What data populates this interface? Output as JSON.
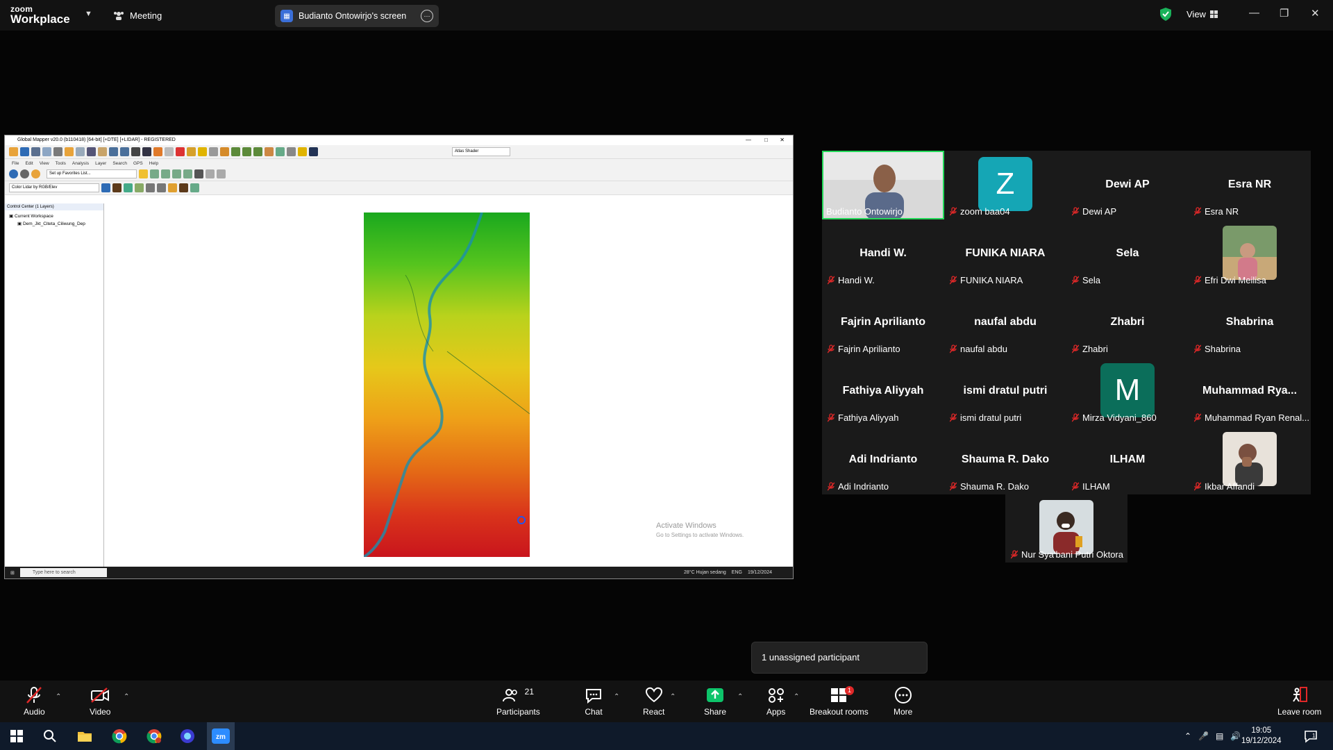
{
  "titlebar": {
    "logo_small": "zoom",
    "logo_big": "Workplace",
    "meeting_label": "Meeting",
    "share_label": "Budianto Ontowirjo's screen",
    "view_label": "View"
  },
  "shared_screen": {
    "window_title": "Global Mapper v20.0 (b110418) [64-bit] [+DTE] [+LIDAR] - REGISTERED",
    "menu": [
      "File",
      "Edit",
      "View",
      "Tools",
      "Analysis",
      "Layer",
      "Search",
      "GPS",
      "Help"
    ],
    "shader_select": "Atlas Shader",
    "favorites_select": "Set up Favorites List...",
    "lidar_select": "Color Lidar by RGB/Elev",
    "control_center": "Control Center (1 Layers)",
    "tree_workspace": "Current Workspace",
    "tree_layer": "Dem_Jkt_Citeta_Ciliwung_Dep",
    "watermark_title": "Activate Windows",
    "watermark_sub": "Go to Settings to activate Windows.",
    "taskbar_search": "Type here to search",
    "weather": "28°C  Hujan sedang",
    "lang": "ENG",
    "date": "19/12/2024"
  },
  "participants": [
    {
      "display": "",
      "label": "Budianto Ontowirjo",
      "type": "video"
    },
    {
      "display": "Z",
      "label": "zoom baa04",
      "type": "letter",
      "color": "#15a6b5"
    },
    {
      "display": "Dewi AP",
      "label": "Dewi AP",
      "type": "name"
    },
    {
      "display": "Esra NR",
      "label": "Esra NR",
      "type": "name"
    },
    {
      "display": "Handi W.",
      "label": "Handi W.",
      "type": "name"
    },
    {
      "display": "FUNIKA NIARA",
      "label": "FUNIKA NIARA",
      "type": "name"
    },
    {
      "display": "Sela",
      "label": "Sela",
      "type": "name"
    },
    {
      "display": "",
      "label": "Efri Dwi Meilisa",
      "type": "photo"
    },
    {
      "display": "Fajrin Aprilianto",
      "label": "Fajrin Aprilianto",
      "type": "name"
    },
    {
      "display": "naufal abdu",
      "label": "naufal abdu",
      "type": "name"
    },
    {
      "display": "Zhabri",
      "label": "Zhabri",
      "type": "name"
    },
    {
      "display": "Shabrina",
      "label": "Shabrina",
      "type": "name"
    },
    {
      "display": "Fathiya Aliyyah",
      "label": "Fathiya Aliyyah",
      "type": "name"
    },
    {
      "display": "ismi dratul putri",
      "label": "ismi dratul putri",
      "type": "name"
    },
    {
      "display": "M",
      "label": "Mirza Vidyani_860",
      "type": "letter",
      "color": "#0b6e5a"
    },
    {
      "display": "Muhammad  Rya...",
      "label": "Muhammad Ryan Renal...",
      "type": "name"
    },
    {
      "display": "Adi Indrianto",
      "label": "Adi Indrianto",
      "type": "name"
    },
    {
      "display": "Shauma R. Dako",
      "label": "Shauma R. Dako",
      "type": "name"
    },
    {
      "display": "ILHAM",
      "label": "ILHAM",
      "type": "name"
    },
    {
      "display": "",
      "label": "Ikbar Affandi",
      "type": "photo"
    },
    {
      "display": "",
      "label": "Nur Sya'bani Putri Oktora",
      "type": "photo"
    }
  ],
  "tooltip": "1 unassigned participant",
  "controls": {
    "audio": "Audio",
    "video": "Video",
    "participants": "Participants",
    "participants_count": "21",
    "chat": "Chat",
    "react": "React",
    "share": "Share",
    "apps": "Apps",
    "breakout": "Breakout rooms",
    "breakout_badge": "1",
    "more": "More",
    "leave": "Leave room"
  },
  "taskbar": {
    "time": "19:05",
    "date": "19/12/2024",
    "notif_count": "1"
  },
  "colors": {
    "active_speaker": "#23d959",
    "mute_red": "#e02828",
    "share_green": "#0dc46a"
  }
}
